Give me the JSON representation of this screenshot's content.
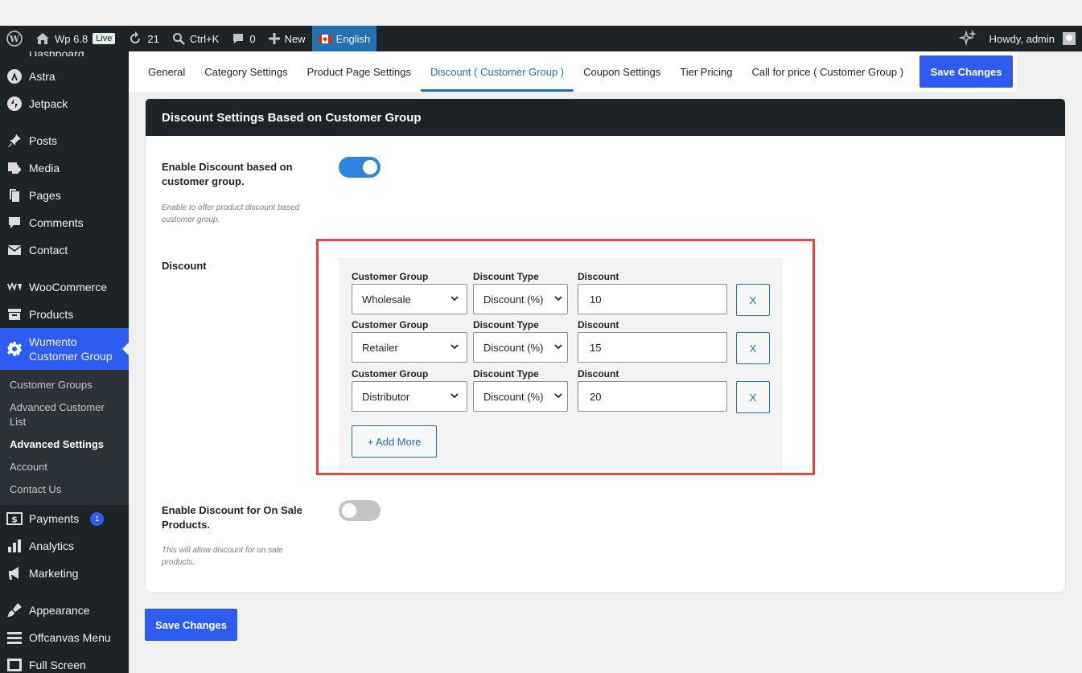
{
  "adminbar": {
    "site_name": "Wp 6.8",
    "live_badge": "Live",
    "updates_count": "21",
    "search_label": "Ctrl+K",
    "comments_count": "0",
    "new_label": "New",
    "language_label": "English",
    "howdy": "Howdy, admin"
  },
  "sidebar": {
    "partial_top": "Dashboard",
    "items": [
      {
        "label": "Astra"
      },
      {
        "label": "Jetpack"
      },
      {
        "label": "Posts"
      },
      {
        "label": "Media"
      },
      {
        "label": "Pages"
      },
      {
        "label": "Comments"
      },
      {
        "label": "Contact"
      },
      {
        "label": "WooCommerce"
      },
      {
        "label": "Products"
      }
    ],
    "active_item": "Wumento Customer Group",
    "submenu": [
      {
        "label": "Customer Groups"
      },
      {
        "label": "Advanced Customer List"
      },
      {
        "label": "Advanced Settings"
      },
      {
        "label": "Account"
      },
      {
        "label": "Contact Us"
      }
    ],
    "items_after": [
      {
        "label": "Payments",
        "badge": "1"
      },
      {
        "label": "Analytics"
      },
      {
        "label": "Marketing"
      },
      {
        "label": "Appearance"
      },
      {
        "label": "Offcanvas Menu"
      },
      {
        "label": "Full Screen"
      }
    ]
  },
  "tabs": [
    {
      "label": "General"
    },
    {
      "label": "Category Settings"
    },
    {
      "label": "Product Page Settings"
    },
    {
      "label": "Discount ( Customer Group )"
    },
    {
      "label": "Coupon Settings"
    },
    {
      "label": "Tier Pricing"
    },
    {
      "label": "Call for price ( Customer Group )"
    }
  ],
  "active_tab": "Discount ( Customer Group )",
  "save_changes_label": "Save Changes",
  "panel": {
    "title": "Discount Settings Based on Customer Group",
    "enable_label": "Enable Discount based on customer group.",
    "enable_desc": "Enable to offer product discount based customer group.",
    "enable_on": true,
    "discount_label": "Discount",
    "col_group": "Customer Group",
    "col_type": "Discount Type",
    "col_discount": "Discount",
    "rules": [
      {
        "group": "Wholesale",
        "type": "Discount (%)",
        "value": "10",
        "remove": "X"
      },
      {
        "group": "Retailer",
        "type": "Discount (%)",
        "value": "15",
        "remove": "X"
      },
      {
        "group": "Distributor",
        "type": "Discount (%)",
        "value": "20",
        "remove": "X"
      }
    ],
    "add_more_label": "+ Add More",
    "onsale_label": "Enable Discount for On Sale Products.",
    "onsale_desc": "This will allow discount for on sale products.",
    "onsale_on": false
  },
  "colors": {
    "primary": "#2e5cf0",
    "admin_dark": "#1d2327",
    "link": "#2271b1",
    "highlight": "#e54545"
  }
}
